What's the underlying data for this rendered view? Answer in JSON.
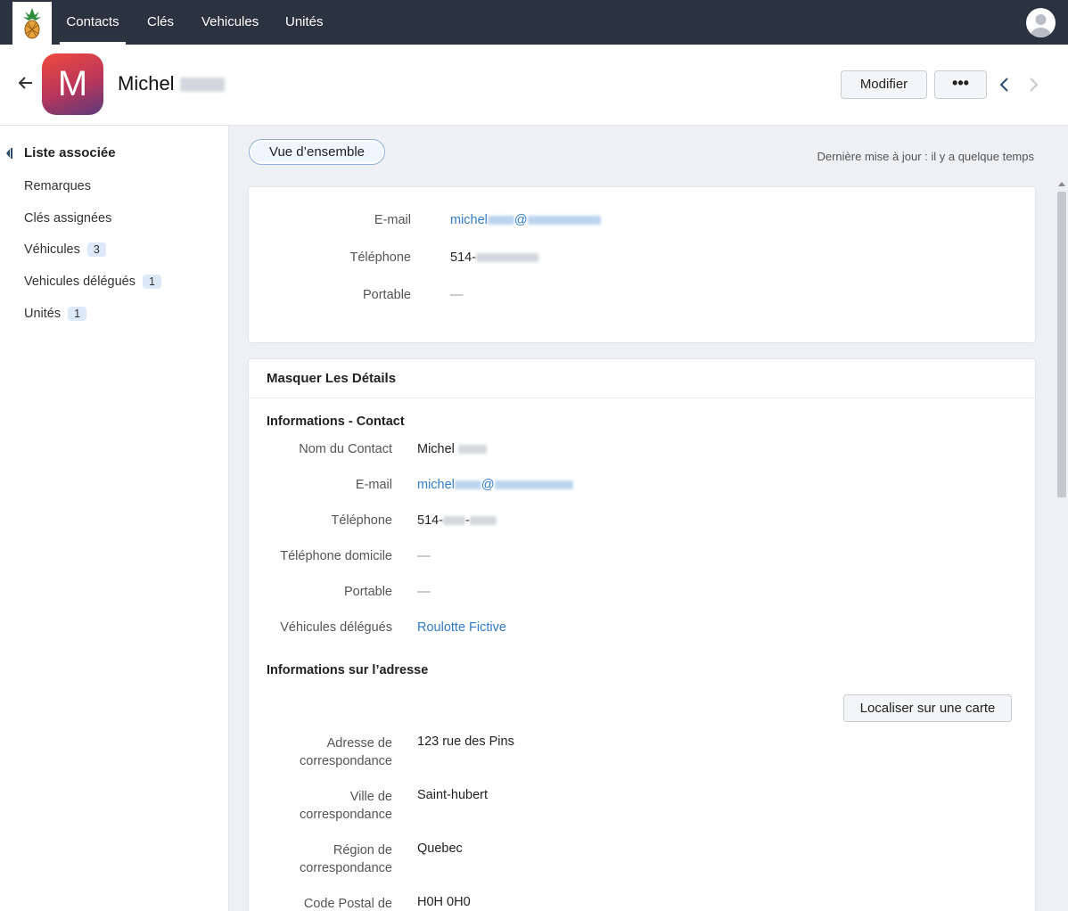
{
  "nav": {
    "tabs": [
      {
        "label": "Contacts",
        "active": true
      },
      {
        "label": "Clés",
        "active": false
      },
      {
        "label": "Vehicules",
        "active": false
      },
      {
        "label": "Unités",
        "active": false
      }
    ]
  },
  "header": {
    "avatar_letter": "M",
    "first_name": "Michel",
    "edit_label": "Modifier",
    "more_label": "•••"
  },
  "sidebar": {
    "title": "Liste associée",
    "items": [
      {
        "label": "Remarques",
        "count": ""
      },
      {
        "label": "Clés assignées",
        "count": ""
      },
      {
        "label": "Véhicules",
        "count": "3"
      },
      {
        "label": "Vehicules délégués",
        "count": "1"
      },
      {
        "label": "Unités",
        "count": "1"
      }
    ]
  },
  "overview": {
    "pill_label": "Vue d’ensemble",
    "last_update": "Dernière mise à jour : il y a quelque temps",
    "fields": [
      {
        "label": "E-mail",
        "value_prefix": "michel",
        "value_mid": "@"
      },
      {
        "label": "Téléphone",
        "value_prefix": "514-"
      },
      {
        "label": "Portable",
        "value": "—"
      }
    ]
  },
  "details": {
    "hide_label": "Masquer Les Détails",
    "contact_section": "Informations - Contact",
    "contact_fields": [
      {
        "label": "Nom du Contact",
        "value": "Michel"
      },
      {
        "label": "E-mail",
        "value": "michel",
        "value_mid": "@"
      },
      {
        "label": "Téléphone",
        "value": "514-",
        "value_mid": "-"
      },
      {
        "label": "Téléphone domicile",
        "value": "—"
      },
      {
        "label": "Portable",
        "value": "—"
      },
      {
        "label": "Véhicules délégués",
        "value": "Roulotte Fictive"
      }
    ],
    "address_section": "Informations sur l’adresse",
    "map_button": "Localiser sur une carte",
    "address_fields": [
      {
        "label_line1": "Adresse de",
        "label_line2": "correspondance",
        "value": "123 rue des Pins"
      },
      {
        "label_line1": "Ville de",
        "label_line2": "correspondance",
        "value": "Saint-hubert"
      },
      {
        "label_line1": "Région de",
        "label_line2": "correspondance",
        "value": "Quebec"
      },
      {
        "label_line1": "Code Postal de",
        "label_line2": "",
        "value": "H0H 0H0"
      }
    ]
  },
  "colors": {
    "topbar": "#2c3340",
    "link": "#2f7bc7",
    "badge": "#dde8f8"
  }
}
